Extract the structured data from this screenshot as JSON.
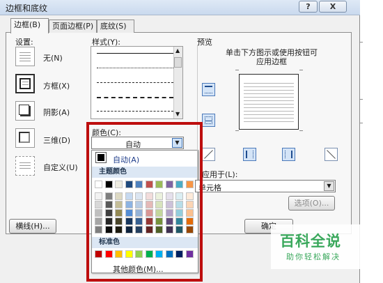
{
  "window": {
    "title": "边框和底纹",
    "help_label": "?",
    "close_label": "X"
  },
  "tabs": [
    {
      "label": "边框(B)",
      "active": true
    },
    {
      "label": "页面边框(P)",
      "active": false
    },
    {
      "label": "底纹(S)",
      "active": false
    }
  ],
  "settings": {
    "heading": "设置:",
    "items": [
      {
        "label": "无(N)",
        "icon": "none-border-icon",
        "selected": false
      },
      {
        "label": "方框(X)",
        "icon": "box-border-icon",
        "selected": true
      },
      {
        "label": "阴影(A)",
        "icon": "shadow-border-icon",
        "selected": false
      },
      {
        "label": "三维(D)",
        "icon": "3d-border-icon",
        "selected": false
      },
      {
        "label": "自定义(U)",
        "icon": "custom-border-icon",
        "selected": false
      }
    ]
  },
  "style": {
    "heading": "样式(Y):",
    "lines": [
      "solid",
      "dotted",
      "dashed",
      "dashed-long",
      "dash-dot"
    ]
  },
  "color": {
    "heading": "颜色(C):",
    "value": "自动",
    "auto_label": "自动(A)",
    "theme_heading": "主题颜色",
    "standard_heading": "标准色",
    "more_colors_label": "其他颜色(M)...",
    "theme_colors": [
      "#ffffff",
      "#000000",
      "#eeece1",
      "#1f497d",
      "#4f81bd",
      "#c0504d",
      "#9bbb59",
      "#8064a2",
      "#4bacc6",
      "#f79646"
    ],
    "theme_tints": [
      [
        "#f2f2f2",
        "#7f7f7f",
        "#ddd9c3",
        "#c6d9f0",
        "#dbe5f1",
        "#f2dcdb",
        "#ebf1dd",
        "#e5e0ec",
        "#dbeef3",
        "#fdeada"
      ],
      [
        "#d8d8d8",
        "#595959",
        "#c4bd97",
        "#8db3e2",
        "#b8cce4",
        "#e5b9b7",
        "#d7e3bc",
        "#ccc1d9",
        "#b7dde8",
        "#fbd5b5"
      ],
      [
        "#bfbfbf",
        "#3f3f3f",
        "#938953",
        "#548dd4",
        "#95b3d7",
        "#d99694",
        "#c3d69b",
        "#b2a2c7",
        "#92cddc",
        "#fac08f"
      ],
      [
        "#a5a5a5",
        "#262626",
        "#494429",
        "#17365d",
        "#366092",
        "#953734",
        "#76923c",
        "#5f497a",
        "#31859b",
        "#e36c09"
      ],
      [
        "#7f7f7f",
        "#0c0c0c",
        "#1d1b10",
        "#0f243e",
        "#244061",
        "#632423",
        "#4f6128",
        "#3f3151",
        "#205867",
        "#974806"
      ]
    ],
    "standard_colors": [
      "#c00000",
      "#ff0000",
      "#ffc000",
      "#ffff00",
      "#92d050",
      "#00b050",
      "#00b0f0",
      "#0070c0",
      "#002060",
      "#7030a0"
    ]
  },
  "preview": {
    "heading": "预览",
    "instruction_line1": "单击下方图示或使用按钮可",
    "instruction_line2": "应用边框"
  },
  "apply_to": {
    "label": "应用于(L):",
    "value": "单元格"
  },
  "buttons": {
    "options": "选项(O)...",
    "horizontal_line": "横线(H)...",
    "ok": "确定"
  },
  "watermark": {
    "title": "百科全说",
    "subtitle": "助你轻松解决"
  }
}
